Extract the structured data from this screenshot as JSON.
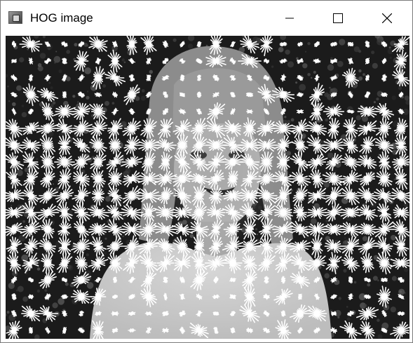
{
  "window": {
    "title": "HOG image",
    "icon": "app-image-icon",
    "controls": [
      "minimize-icon",
      "maximize-icon",
      "close-icon"
    ]
  },
  "image": {
    "description_icon": "hog-visualization-image",
    "cell_grid": {
      "columns": 24,
      "rows": 18
    },
    "glyph_color": "#ffffff",
    "background_color": "#1b1b1b"
  }
}
